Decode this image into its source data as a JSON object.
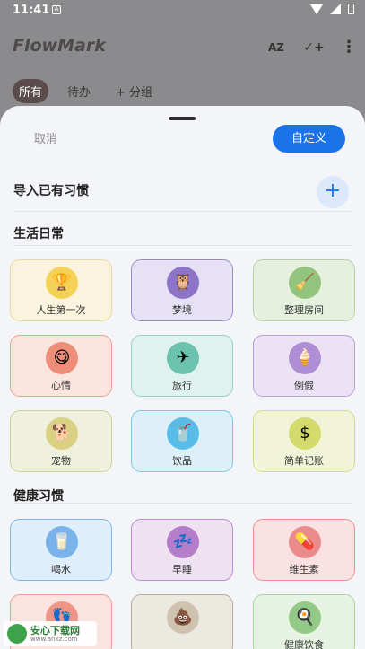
{
  "status_bar": {
    "time": "11:41",
    "app_badge": "A"
  },
  "app": {
    "title": "FlowMark",
    "actions": {
      "sort_label": "AZ",
      "add_label": "✓+",
      "more_label": "⋮"
    },
    "filters": [
      {
        "label": "所有",
        "active": true
      },
      {
        "label": "待办",
        "active": false
      },
      {
        "label": "+ 分组",
        "active": false
      }
    ]
  },
  "sheet": {
    "cancel_label": "取消",
    "custom_label": "自定义",
    "import_label": "导入已有习惯",
    "import_add_label": "+",
    "sections": [
      {
        "title": "生活日常",
        "cards": [
          {
            "label": "人生第一次",
            "icon": "trophy-icon",
            "glyph": "🏆",
            "bg": "#faf3dd",
            "border": "#e8d99a",
            "icon_bg": "#f4d257"
          },
          {
            "label": "梦境",
            "icon": "owl-icon",
            "glyph": "🦉",
            "bg": "#e6e1f4",
            "border": "#9c8ad0",
            "icon_bg": "#8d74c9"
          },
          {
            "label": "整理房间",
            "icon": "broom-icon",
            "glyph": "🧹",
            "bg": "#e6f0df",
            "border": "#b7d2a2",
            "icon_bg": "#93c47d"
          },
          {
            "label": "心情",
            "icon": "smile-icon",
            "glyph": "😋",
            "bg": "#fbe6df",
            "border": "#ef9e8c",
            "icon_bg": "#ee8e78"
          },
          {
            "label": "旅行",
            "icon": "airplane-icon",
            "glyph": "✈",
            "bg": "#dff2ee",
            "border": "#95d2c3",
            "icon_bg": "#6cc3ad"
          },
          {
            "label": "例假",
            "icon": "icecream-icon",
            "glyph": "🍦",
            "bg": "#ebe3f4",
            "border": "#ba9ed9",
            "icon_bg": "#b08ed5"
          },
          {
            "label": "宠物",
            "icon": "dog-icon",
            "glyph": "🐕",
            "bg": "#eff0dd",
            "border": "#cfd29b",
            "icon_bg": "#d9d084"
          },
          {
            "label": "饮品",
            "icon": "cup-icon",
            "glyph": "🥤",
            "bg": "#def0f7",
            "border": "#7cc9e8",
            "icon_bg": "#58bce6"
          },
          {
            "label": "简单记账",
            "icon": "dollar-icon",
            "glyph": "$",
            "bg": "#f1f4d8",
            "border": "#d3dc82",
            "icon_bg": "#d4db6c"
          }
        ]
      },
      {
        "title": "健康习惯",
        "cards": [
          {
            "label": "喝水",
            "icon": "water-glass-icon",
            "glyph": "🥛",
            "bg": "#dfeefb",
            "border": "#7fb7ea",
            "icon_bg": "#7ab3ea"
          },
          {
            "label": "早睡",
            "icon": "sleep-icon",
            "glyph": "💤",
            "bg": "#eee1f2",
            "border": "#c08ad2",
            "icon_bg": "#b37dca"
          },
          {
            "label": "维生素",
            "icon": "pill-icon",
            "glyph": "💊",
            "bg": "#fbe2e2",
            "border": "#e99191",
            "icon_bg": "#ec8b8b"
          },
          {
            "label": "",
            "icon": "footprints-icon",
            "glyph": "👣",
            "bg": "#fbe4e0",
            "border": "#ee9f92",
            "icon_bg": "#ee9585"
          },
          {
            "label": "",
            "icon": "poop-icon",
            "glyph": "💩",
            "bg": "#ece9e1",
            "border": "#b7ad9b",
            "icon_bg": "#cfc3b0"
          },
          {
            "label": "健康饮食",
            "icon": "egg-icon",
            "glyph": "🍳",
            "bg": "#e6f3e2",
            "border": "#a7d49c",
            "icon_bg": "#93c987"
          }
        ]
      }
    ]
  },
  "watermark": {
    "title": "安心下载网",
    "subtitle": "www.anxz.com"
  }
}
